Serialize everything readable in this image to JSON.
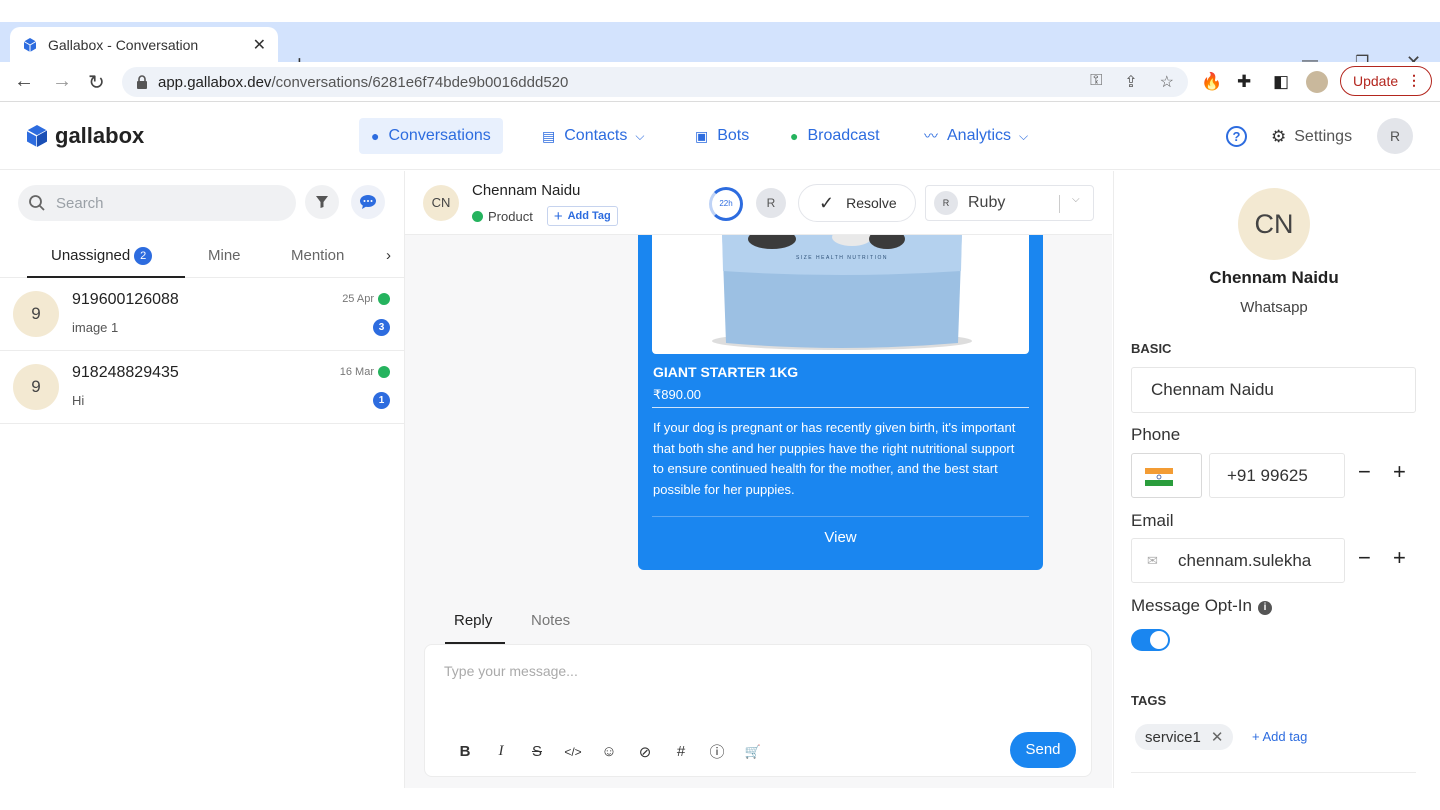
{
  "browser": {
    "tab_title": "Gallabox - Conversation",
    "tab_close": "✕",
    "new_tab": "+",
    "url_host": "app.gallabox.dev",
    "url_path": "/conversations/6281e6f74bde9b0016ddd520",
    "update_label": "Update"
  },
  "app": {
    "logo": "gallabox",
    "nav": [
      {
        "label": "Conversations"
      },
      {
        "label": "Contacts"
      },
      {
        "label": "Bots"
      },
      {
        "label": "Broadcast"
      },
      {
        "label": "Analytics"
      }
    ],
    "settings_label": "Settings",
    "user_initial": "R"
  },
  "left": {
    "search_placeholder": "Search",
    "tabs": [
      {
        "label": "Unassigned",
        "badge": "2"
      },
      {
        "label": "Mine"
      },
      {
        "label": "Mention"
      }
    ],
    "conversations": [
      {
        "initial": "9",
        "name": "919600126088",
        "preview": "image 1",
        "date": "25 Apr",
        "unread": "3"
      },
      {
        "initial": "9",
        "name": "918248829435",
        "preview": "Hi",
        "date": "16 Mar",
        "unread": "1"
      }
    ]
  },
  "chat": {
    "contact_initials": "CN",
    "contact_name": "Chennam Naidu",
    "channel_label": "Product",
    "add_tag_label": "Add Tag",
    "timer_label": "22h",
    "agent_initial": "R",
    "resolve_label": "Resolve",
    "assignee_initial": "R",
    "assignee_name": "Ruby",
    "product_card": {
      "title": "GIANT STARTER 1KG",
      "price": "₹890.00",
      "description": "If your dog is pregnant or has recently given birth, it's important that both she and her puppies have the right nutritional support to ensure continued health for the mother, and the best start possible for her puppies.",
      "button_label": "View",
      "package_text": "SIZE HEALTH NUTRITION"
    },
    "reply_tabs": [
      {
        "label": "Reply"
      },
      {
        "label": "Notes"
      }
    ],
    "composer_placeholder": "Type your message...",
    "send_label": "Send",
    "toolbar": [
      "B",
      "I",
      "S",
      "</>",
      "☺",
      "⊘",
      "#",
      "ⓘ",
      "🛒"
    ]
  },
  "profile": {
    "initials": "CN",
    "name": "Chennam Naidu",
    "channel": "Whatsapp",
    "basic_heading": "BASIC",
    "name_value": "Chennam Naidu",
    "phone_label": "Phone",
    "phone_value": "+91 99625",
    "email_label": "Email",
    "email_value": "chennam.sulekha",
    "optin_label": "Message Opt-In",
    "optin_on": true,
    "tags_heading": "TAGS",
    "tags": [
      "service1"
    ],
    "add_tag_label": "+ Add tag"
  },
  "colors": {
    "accent": "#2d6cdf",
    "card_blue": "#1a86f0",
    "whatsapp": "#25b35e",
    "chrome_tabbar": "#d3e3fd"
  }
}
